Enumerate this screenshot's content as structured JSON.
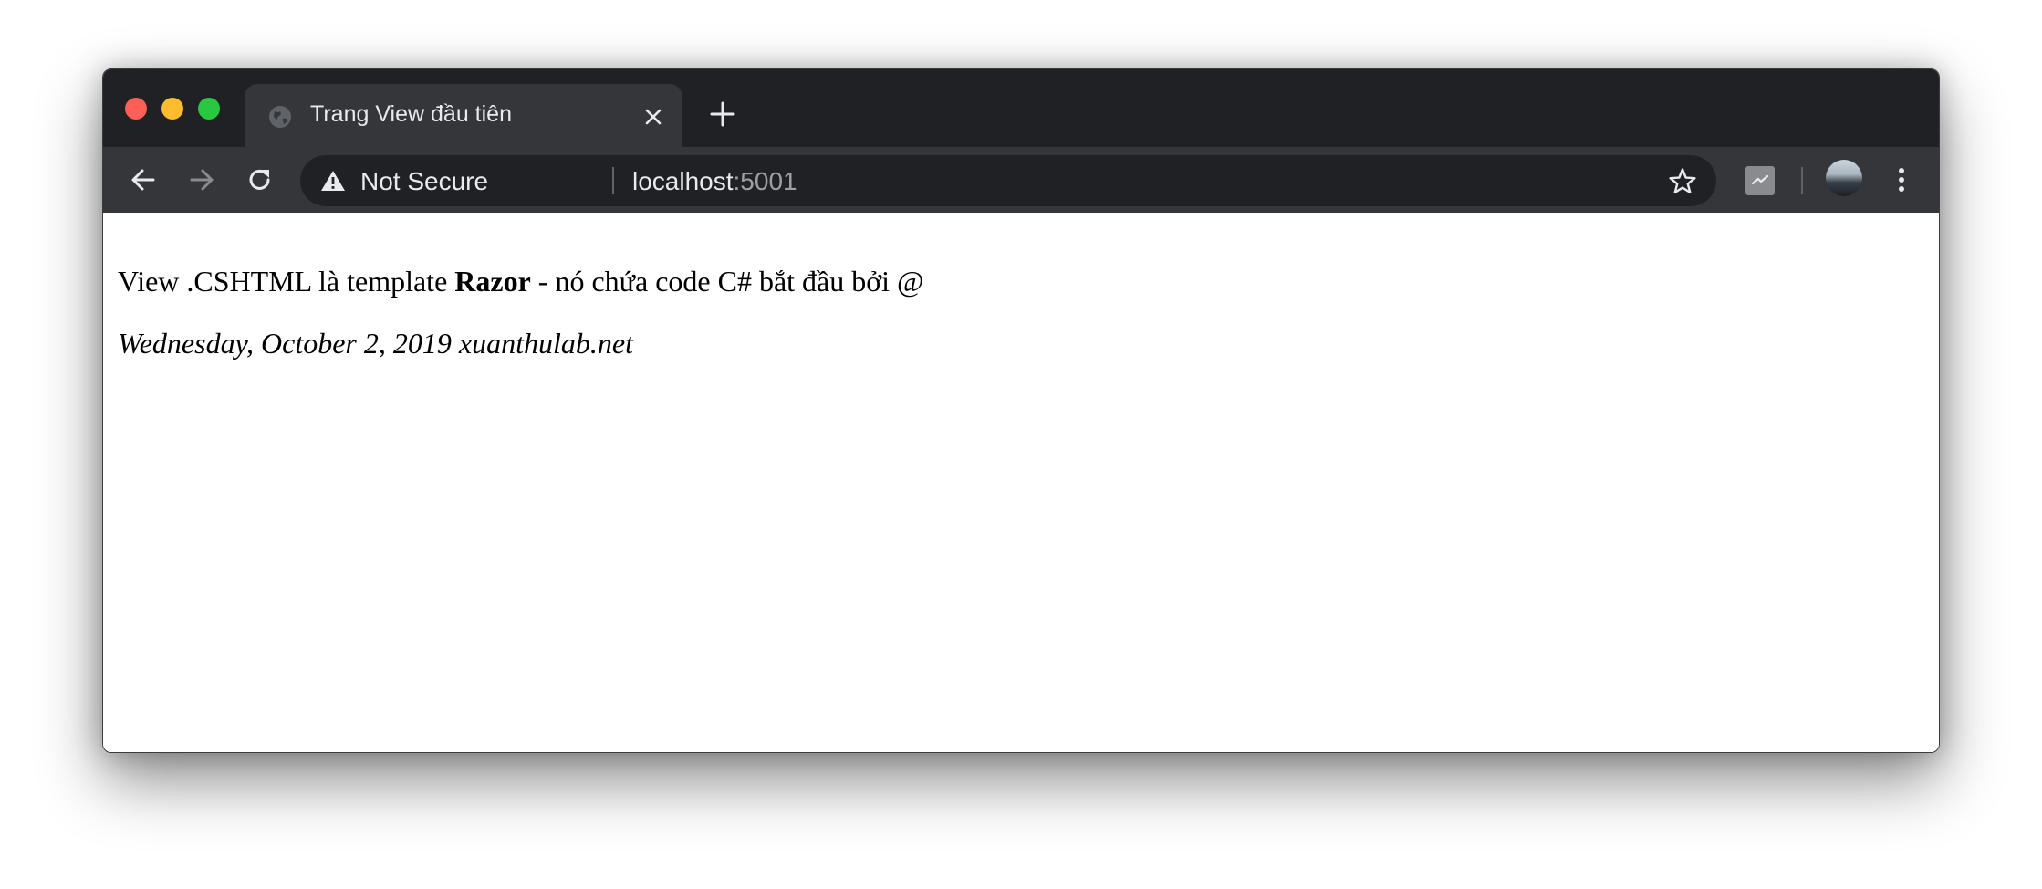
{
  "window_controls": {
    "close_color": "#fe5f57",
    "minimize_color": "#febc2e",
    "maximize_color": "#28c840"
  },
  "tab": {
    "title": "Trang View đầu tiên",
    "favicon": "globe-icon",
    "close_icon": "close-icon"
  },
  "new_tab_icon": "plus-icon",
  "toolbar": {
    "back_icon": "arrow-left-icon",
    "forward_icon": "arrow-right-icon",
    "reload_icon": "reload-icon",
    "security_icon": "warning-triangle-icon",
    "security_label": "Not Secure",
    "url_host": "localhost",
    "url_port": ":5001",
    "bookmark_icon": "star-icon",
    "extension_icon": "extension-icon",
    "profile_icon": "avatar",
    "menu_icon": "kebab-menu-icon"
  },
  "content": {
    "line1_before": "View .CSHTML là template ",
    "line1_bold": "Razor",
    "line1_after": " - nó chứa code C# bắt đầu bởi @",
    "line2": "Wednesday, October 2, 2019 xuanthulab.net"
  },
  "colors": {
    "tabstrip": "#202124",
    "toolbar": "#35363a",
    "omnibox": "#202124",
    "text_light": "#e8eaed",
    "text_dim": "#9aa0a6"
  }
}
